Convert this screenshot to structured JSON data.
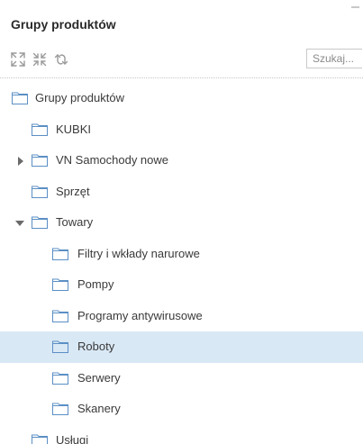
{
  "panel": {
    "title": "Grupy produktów"
  },
  "toolbar": {
    "expand_icon": "expand-all-icon",
    "collapse_icon": "collapse-all-icon",
    "refresh_icon": "refresh-icon",
    "search_placeholder": "Szukaj..."
  },
  "tree": {
    "root": {
      "label": "Grupy produktów",
      "icon": "folder-icon"
    },
    "items": [
      {
        "label": "KUBKI"
      },
      {
        "label": "VN Samochody nowe",
        "state": "collapsed"
      },
      {
        "label": "Sprzęt"
      },
      {
        "label": "Towary",
        "state": "expanded"
      },
      {
        "label": "Filtry i wkłady narurowe"
      },
      {
        "label": "Pompy"
      },
      {
        "label": "Programy antywirusowe"
      },
      {
        "label": "Roboty",
        "selected": true
      },
      {
        "label": "Serwery"
      },
      {
        "label": "Skanery"
      },
      {
        "label": "Usługi"
      }
    ]
  },
  "colors": {
    "selected_background": "#d9e8f5",
    "folder_stroke": "#5b8fc4",
    "icon_gray": "#9a9a9a"
  }
}
